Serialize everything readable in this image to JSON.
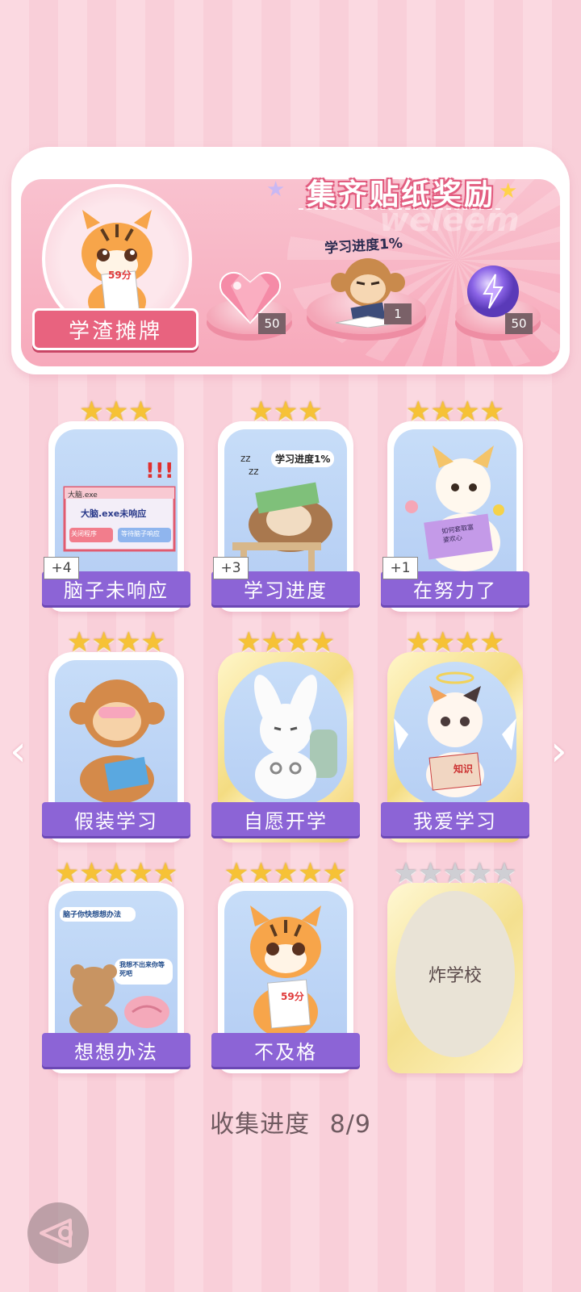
{
  "banner": {
    "title": "集齐贴纸奖励",
    "watermark": "weleem",
    "character_plaque": "学渣摊牌",
    "tiger_paper": "59分",
    "monkey_caption": "学习进度1%",
    "rewards": [
      {
        "name": "pink-heart-gem",
        "count": "50"
      },
      {
        "name": "monkey-sticker",
        "count": "1"
      },
      {
        "name": "purple-orb",
        "count": "50"
      }
    ]
  },
  "stickers": [
    {
      "label": "脑子未响应",
      "stars": "★★★",
      "plus": "+4",
      "window_title": "大脑.exe",
      "window_msg": "大脑.exe未响应",
      "btn1": "关闭程序",
      "btn2": "等待脑子响应"
    },
    {
      "label": "学习进度",
      "stars": "★★★",
      "plus": "+3",
      "caption": "学习进度1%"
    },
    {
      "label": "在努力了",
      "stars": "★★★★",
      "plus": "+1",
      "book_text": "如何套取富婆欢心"
    },
    {
      "label": "假装学习",
      "stars": "★★★★"
    },
    {
      "label": "自愿开学",
      "stars": "★★★★"
    },
    {
      "label": "我爱学习",
      "stars": "★★★★",
      "book_text": "知识"
    },
    {
      "label": "想想办法",
      "stars": "★★★★★",
      "bubble1": "脑子你快想想办法",
      "bubble2": "我想不出来你等死吧"
    },
    {
      "label": "不及格",
      "stars": "★★★★★",
      "paper": "59分"
    },
    {
      "label": "炸学校",
      "stars": "★★★★★",
      "locked": true
    }
  ],
  "collection": {
    "label": "收集进度",
    "value": "8/9"
  }
}
